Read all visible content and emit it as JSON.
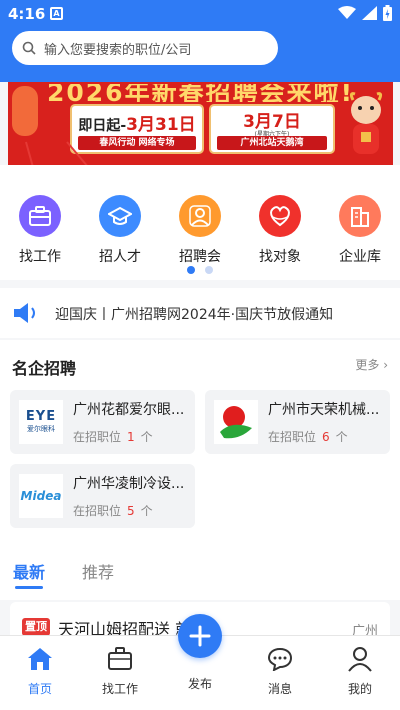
{
  "status_bar": {
    "time": "4:16",
    "notification_letter": "A"
  },
  "search": {
    "placeholder": "输入您要搜索的职位/公司"
  },
  "banner": {
    "title": "2026年新春招聘会来啦!",
    "card1": {
      "prefix": "即日起-",
      "date": "3月31日",
      "tag": "春风行动 网络专场"
    },
    "card2": {
      "date": "3月7日",
      "weekday": "(星期六下午)",
      "tag": "广州北站天鹅湾"
    }
  },
  "quick_entries": [
    {
      "label": "找工作",
      "icon": "briefcase-icon",
      "color": "#7b61ff"
    },
    {
      "label": "招人才",
      "icon": "graduation-cap-icon",
      "color": "#3d8bff"
    },
    {
      "label": "招聘会",
      "icon": "presenter-icon",
      "color": "#ff9a2e"
    },
    {
      "label": "找对象",
      "icon": "heart-hands-icon",
      "color": "#f0312c"
    },
    {
      "label": "企业库",
      "icon": "building-icon",
      "color": "#ff7a5c"
    }
  ],
  "notice": {
    "text": "迎国庆丨广州招聘网2024年·国庆节放假通知"
  },
  "famous": {
    "title": "名企招聘",
    "more": "更多",
    "companies": [
      {
        "name": "广州花都爱尔眼...",
        "meta_prefix": "在招职位",
        "count": "1",
        "meta_suffix": "个",
        "logo_text": "EYE",
        "logo_sub": "爱尔眼科"
      },
      {
        "name": "广州市天荣机械...",
        "meta_prefix": "在招职位",
        "count": "6",
        "meta_suffix": "个",
        "logo_text": "",
        "logo_sub": ""
      },
      {
        "name": "广州华凌制冷设...",
        "meta_prefix": "在招职位",
        "count": "5",
        "meta_suffix": "个",
        "logo_text": "Midea",
        "logo_sub": ""
      }
    ]
  },
  "feed_tabs": {
    "latest": "最新",
    "recommend": "推荐"
  },
  "job": {
    "badge": "置顶",
    "title": "天河山姆招配送 就近",
    "city": "广州"
  },
  "bottom_nav": {
    "home": "首页",
    "jobs": "找工作",
    "publish": "发布",
    "messages": "消息",
    "mine": "我的"
  },
  "colors": {
    "primary": "#2f7bf5",
    "banner_red": "#d8211d",
    "count_red": "#e53935"
  }
}
